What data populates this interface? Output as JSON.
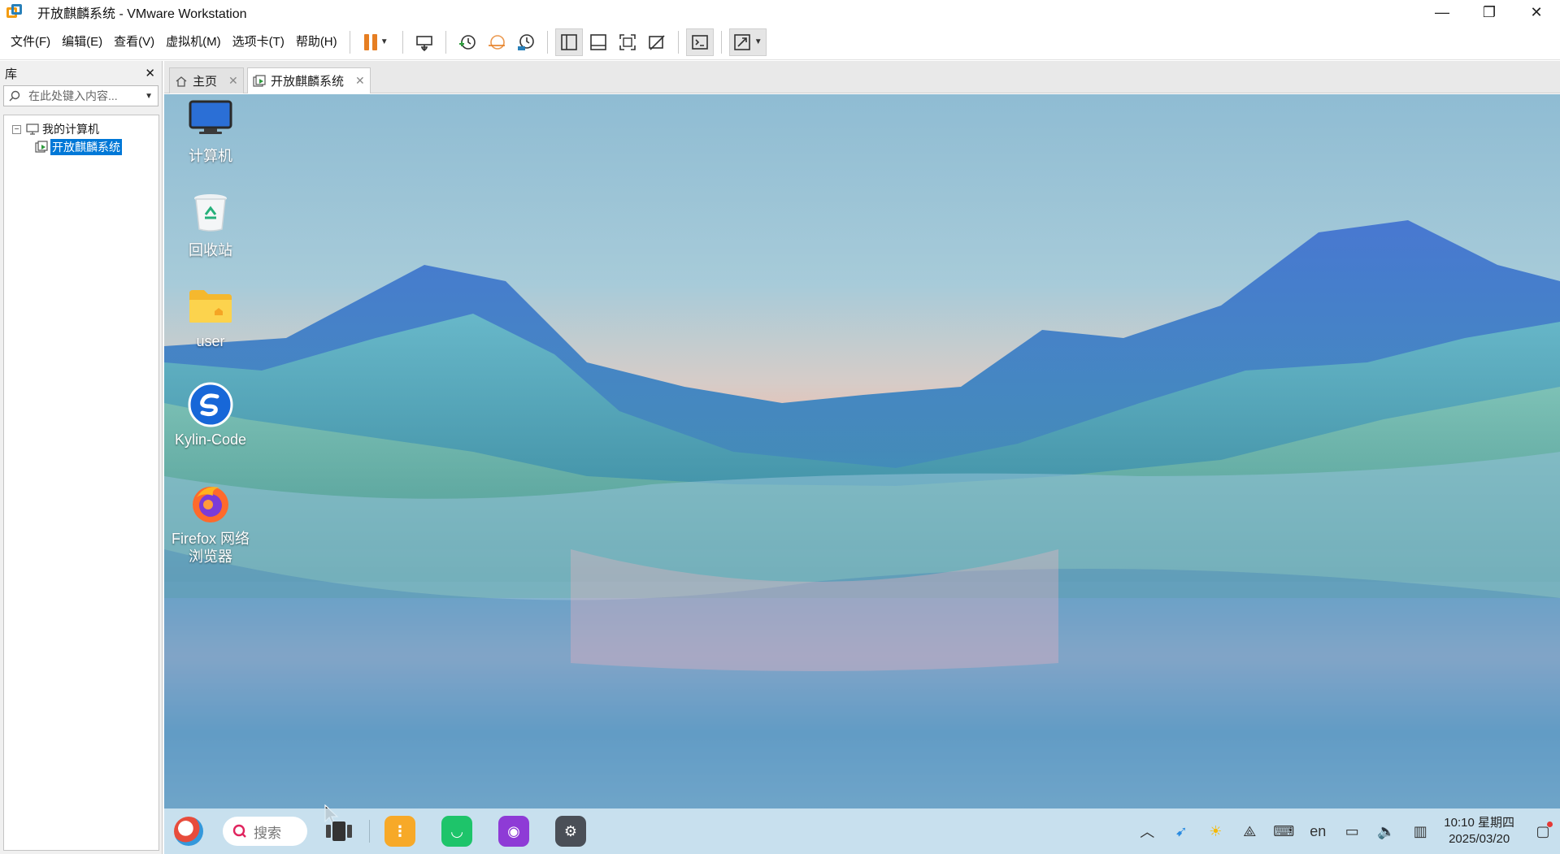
{
  "window": {
    "title": "开放麒麟系统 - VMware Workstation",
    "minimize_symbol": "—",
    "restore_symbol": "❐",
    "close_symbol": "✕"
  },
  "menu": {
    "file": "文件(F)",
    "edit": "编辑(E)",
    "view": "查看(V)",
    "vm": "虚拟机(M)",
    "tabs": "选项卡(T)",
    "help": "帮助(H)"
  },
  "library": {
    "title": "库",
    "close_symbol": "✕",
    "search_placeholder": "在此处键入内容...",
    "tree": {
      "root_label": "我的计算机",
      "root_expander": "−",
      "child_label": "开放麒麟系统"
    }
  },
  "tabs": [
    {
      "label": "主页",
      "close": "✕"
    },
    {
      "label": "开放麒麟系统",
      "close": "✕"
    }
  ],
  "desktop": {
    "icons": [
      {
        "label": "计算机",
        "icon": "monitor-icon"
      },
      {
        "label": "回收站",
        "icon": "trash-icon"
      },
      {
        "label": "user",
        "icon": "folder-icon"
      },
      {
        "label": "Kylin-Code",
        "icon": "kylin-code-icon"
      },
      {
        "label": "Firefox 网络浏览器",
        "icon": "firefox-icon"
      }
    ]
  },
  "taskbar": {
    "search_label": "搜索",
    "input_method": "en",
    "clock_time": "10:10 星期四",
    "clock_date": "2025/03/20"
  }
}
